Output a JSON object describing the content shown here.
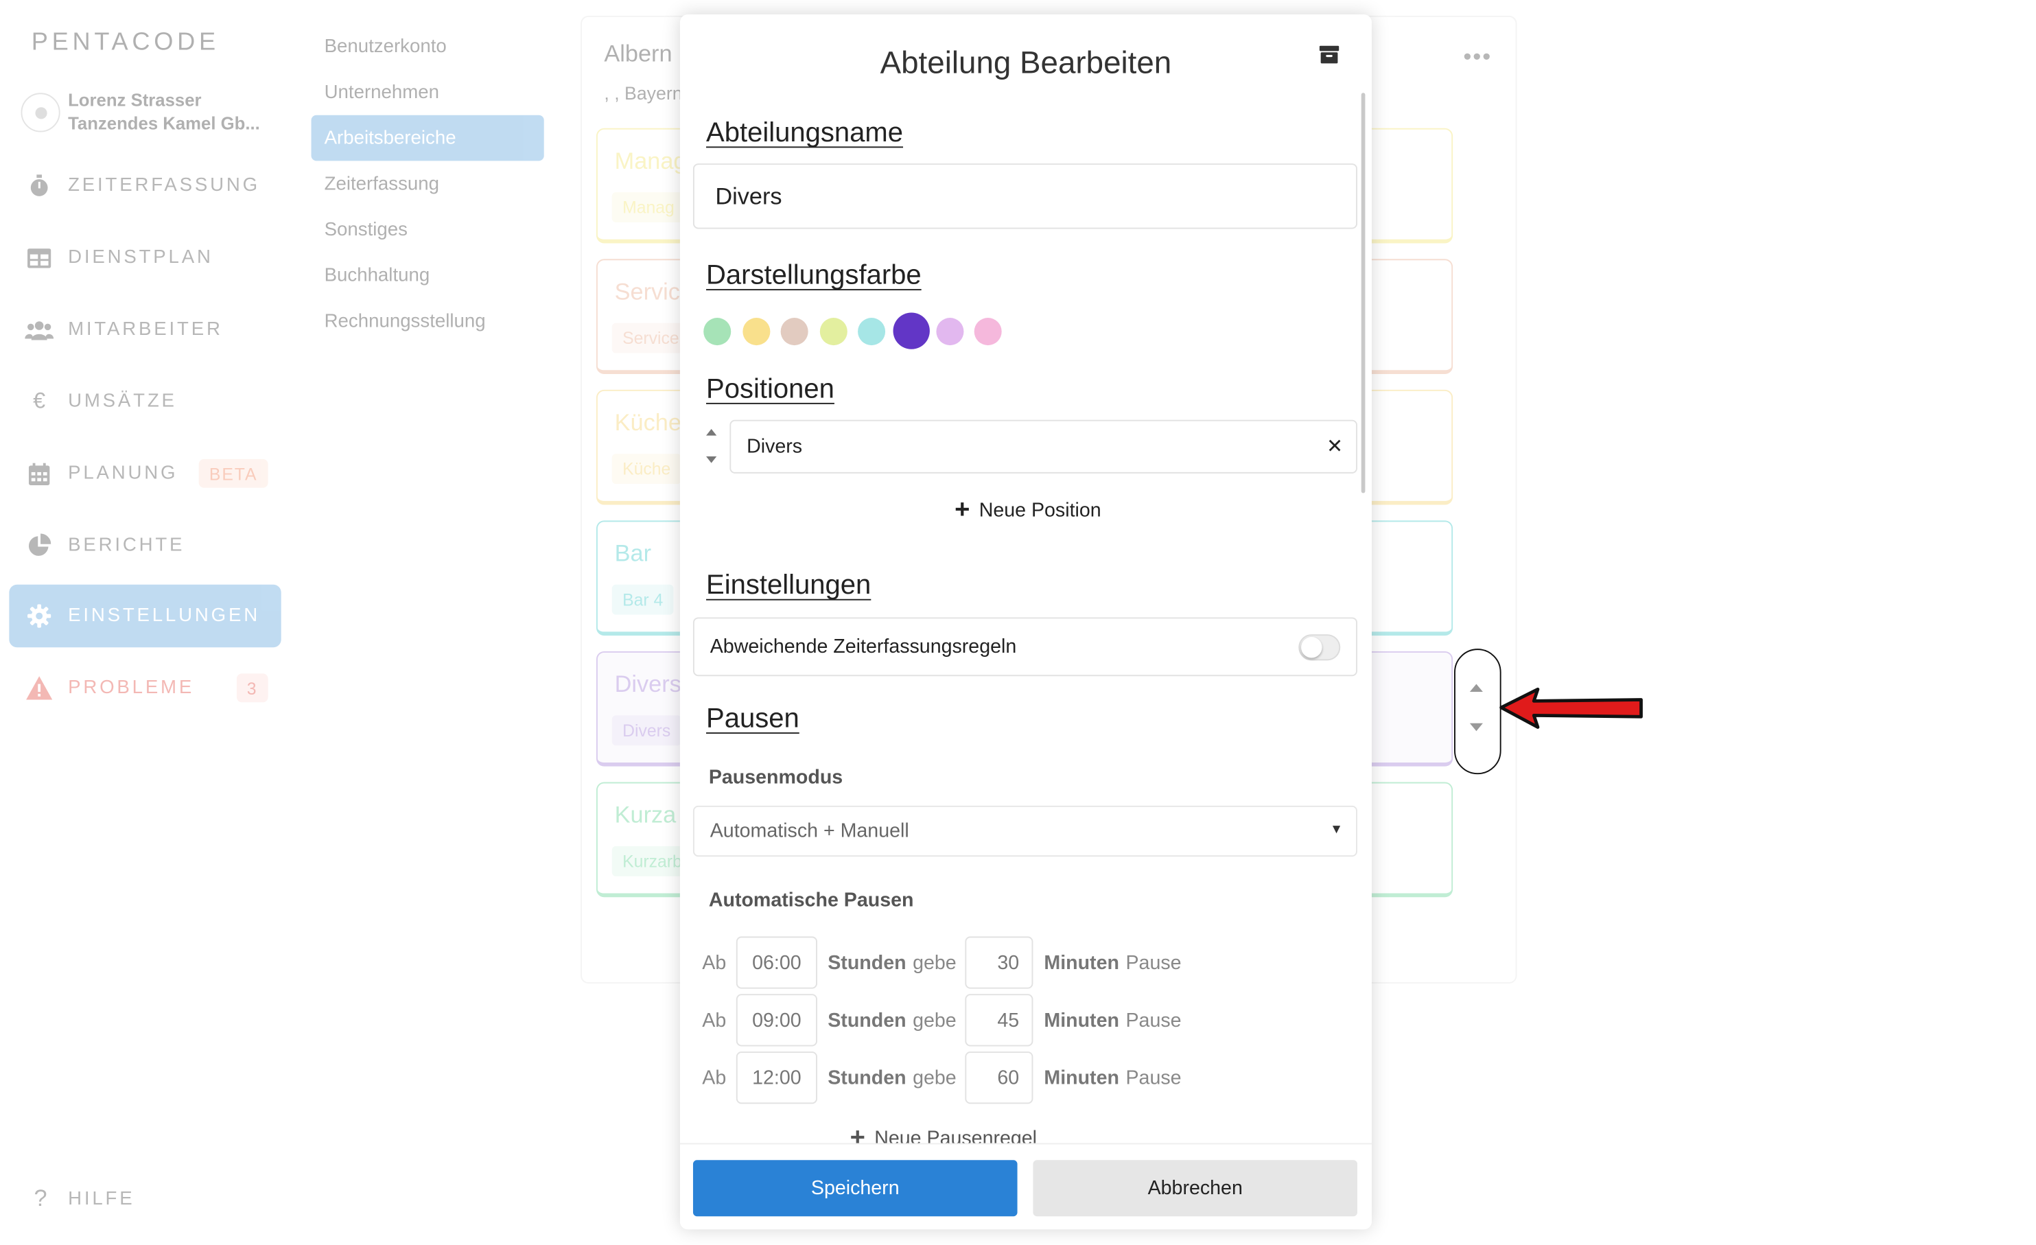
{
  "app": {
    "logo": "PENTACODE"
  },
  "user": {
    "name": "Lorenz Strasser",
    "company": "Tanzendes Kamel Gb..."
  },
  "nav": {
    "items": [
      {
        "label": "ZEITERFASSUNG",
        "icon": "stopwatch-icon"
      },
      {
        "label": "DIENSTPLAN",
        "icon": "table-icon"
      },
      {
        "label": "MITARBEITER",
        "icon": "users-icon"
      },
      {
        "label": "UMSÄTZE",
        "icon": "euro-icon",
        "glyph": "€"
      },
      {
        "label": "PLANUNG",
        "icon": "calendar-icon",
        "badge": "BETA"
      },
      {
        "label": "BERICHTE",
        "icon": "pie-chart-icon"
      },
      {
        "label": "EINSTELLUNGEN",
        "icon": "gear-icon",
        "active": true
      },
      {
        "label": "PROBLEME",
        "icon": "warning-icon",
        "badge": "3"
      }
    ],
    "help": "HILFE"
  },
  "subnav": {
    "items": [
      "Benutzerkonto",
      "Unternehmen",
      "Arbeitsbereiche",
      "Zeiterfassung",
      "Sonstiges",
      "Buchhaltung",
      "Rechnungsstellung"
    ],
    "active": "Arbeitsbereiche"
  },
  "page": {
    "title": "Albern",
    "subtitle": ", , Bayern",
    "departments": [
      {
        "name": "Manag",
        "chip": "Manag",
        "color": "#f2e36a"
      },
      {
        "name": "Servic",
        "chip": "Service",
        "color": "#e8a98a"
      },
      {
        "name": "Küche",
        "chip": "Küche",
        "color": "#f5d26a"
      },
      {
        "name": "Bar",
        "chip": "Bar 4",
        "color": "#3cc8c8"
      },
      {
        "name": "Divers",
        "chip": "Divers",
        "color": "#9f7ad6"
      },
      {
        "name": "Kurza",
        "chip": "Kurzarb",
        "color": "#5dd08f"
      }
    ]
  },
  "modal": {
    "title": "Abteilung Bearbeiten",
    "name_heading": "Abteilungsname",
    "name_value": "Divers",
    "color_heading": "Darstellungsfarbe",
    "colors": [
      "#a6e3b7",
      "#f9e08c",
      "#e2cbc0",
      "#e3ef9f",
      "#a6e6e6",
      "#6236c6",
      "#e2b8ef",
      "#f5b8dc"
    ],
    "selected_color": "#6236c6",
    "positions_heading": "Positionen",
    "positions": [
      "Divers"
    ],
    "add_position": "Neue Position",
    "settings_heading": "Einstellungen",
    "toggle_label": "Abweichende Zeiterfassungsregeln",
    "toggle_on": false,
    "breaks_heading": "Pausen",
    "break_mode_label": "Pausenmodus",
    "break_mode_value": "Automatisch + Manuell",
    "auto_breaks_label": "Automatische Pausen",
    "rule_words": {
      "from": "Ab",
      "hours": "Stunden",
      "give": "gebe",
      "minutes": "Minuten",
      "pause": "Pause"
    },
    "rules": [
      {
        "from": "06:00",
        "minutes": "30"
      },
      {
        "from": "09:00",
        "minutes": "45"
      },
      {
        "from": "12:00",
        "minutes": "60"
      }
    ],
    "add_rule": "Neue Pausenregel",
    "save": "Speichern",
    "cancel": "Abbrechen"
  },
  "colors": {
    "accent": "#2a82d6",
    "active_nav": "#5da3dd",
    "danger": "#e2463d",
    "annotation_arrow": "#e01b1b"
  }
}
